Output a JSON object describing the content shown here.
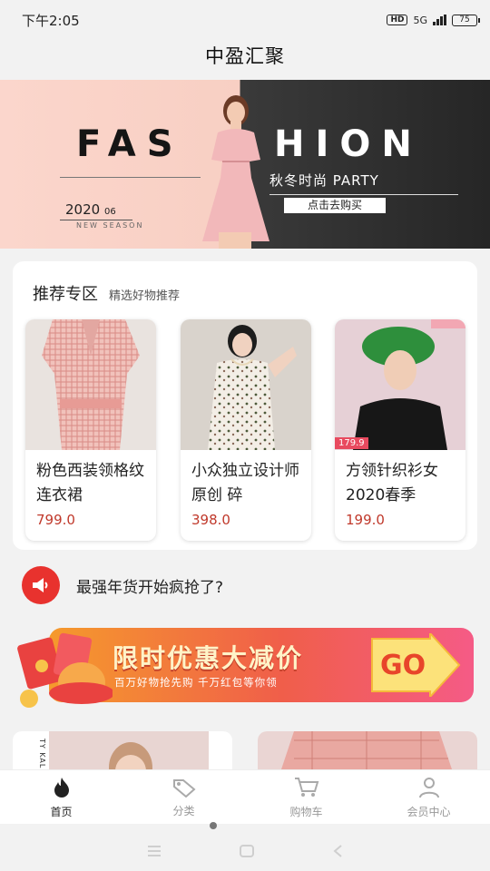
{
  "status": {
    "time": "下午2:05",
    "hd": "HD",
    "signal": "5G",
    "battery": "75"
  },
  "app": {
    "title": "中盈汇聚"
  },
  "banner": {
    "word_left": "FAS",
    "word_right": "HION",
    "subtitle": "秋冬时尚 PARTY",
    "cta": "点击去购买",
    "year": "2020",
    "month": "06",
    "season": "NEW SEASON"
  },
  "recommend": {
    "title": "推荐专区",
    "subtitle": "精选好物推荐",
    "products": [
      {
        "name": "粉色西装领格纹连衣裙",
        "price": "799.0"
      },
      {
        "name": "小众独立设计师原创 碎",
        "price": "398.0"
      },
      {
        "name": "方领针织衫女2020春季",
        "price": "199.0",
        "tag": "179.9"
      }
    ]
  },
  "notice": {
    "text": "最强年货开始疯抢了?"
  },
  "promo": {
    "title": "限时优惠大减价",
    "subtitle": "百万好物抢先购 千万红包等你领",
    "go": "GO"
  },
  "peek": {
    "side_text": "TY KALEI"
  },
  "tabs": [
    {
      "label": "首页",
      "icon": "flame-icon",
      "active": true
    },
    {
      "label": "分类",
      "icon": "tag-icon",
      "active": false
    },
    {
      "label": "购物车",
      "icon": "cart-icon",
      "active": false
    },
    {
      "label": "会员中心",
      "icon": "user-icon",
      "active": false
    }
  ],
  "colors": {
    "accent_red": "#e8322e",
    "price_red": "#c0392b",
    "promo_orange": "#f59a2c"
  }
}
